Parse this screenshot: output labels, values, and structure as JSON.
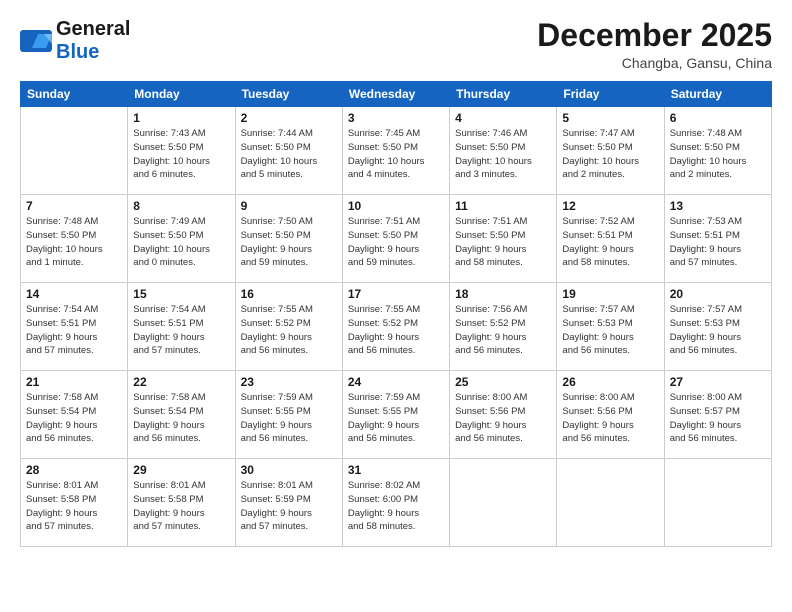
{
  "logo": {
    "line1": "General",
    "line2": "Blue"
  },
  "title": "December 2025",
  "location": "Changba, Gansu, China",
  "days_of_week": [
    "Sunday",
    "Monday",
    "Tuesday",
    "Wednesday",
    "Thursday",
    "Friday",
    "Saturday"
  ],
  "weeks": [
    [
      {
        "day": "",
        "info": ""
      },
      {
        "day": "1",
        "info": "Sunrise: 7:43 AM\nSunset: 5:50 PM\nDaylight: 10 hours\nand 6 minutes."
      },
      {
        "day": "2",
        "info": "Sunrise: 7:44 AM\nSunset: 5:50 PM\nDaylight: 10 hours\nand 5 minutes."
      },
      {
        "day": "3",
        "info": "Sunrise: 7:45 AM\nSunset: 5:50 PM\nDaylight: 10 hours\nand 4 minutes."
      },
      {
        "day": "4",
        "info": "Sunrise: 7:46 AM\nSunset: 5:50 PM\nDaylight: 10 hours\nand 3 minutes."
      },
      {
        "day": "5",
        "info": "Sunrise: 7:47 AM\nSunset: 5:50 PM\nDaylight: 10 hours\nand 2 minutes."
      },
      {
        "day": "6",
        "info": "Sunrise: 7:48 AM\nSunset: 5:50 PM\nDaylight: 10 hours\nand 2 minutes."
      }
    ],
    [
      {
        "day": "7",
        "info": "Sunrise: 7:48 AM\nSunset: 5:50 PM\nDaylight: 10 hours\nand 1 minute."
      },
      {
        "day": "8",
        "info": "Sunrise: 7:49 AM\nSunset: 5:50 PM\nDaylight: 10 hours\nand 0 minutes."
      },
      {
        "day": "9",
        "info": "Sunrise: 7:50 AM\nSunset: 5:50 PM\nDaylight: 9 hours\nand 59 minutes."
      },
      {
        "day": "10",
        "info": "Sunrise: 7:51 AM\nSunset: 5:50 PM\nDaylight: 9 hours\nand 59 minutes."
      },
      {
        "day": "11",
        "info": "Sunrise: 7:51 AM\nSunset: 5:50 PM\nDaylight: 9 hours\nand 58 minutes."
      },
      {
        "day": "12",
        "info": "Sunrise: 7:52 AM\nSunset: 5:51 PM\nDaylight: 9 hours\nand 58 minutes."
      },
      {
        "day": "13",
        "info": "Sunrise: 7:53 AM\nSunset: 5:51 PM\nDaylight: 9 hours\nand 57 minutes."
      }
    ],
    [
      {
        "day": "14",
        "info": "Sunrise: 7:54 AM\nSunset: 5:51 PM\nDaylight: 9 hours\nand 57 minutes."
      },
      {
        "day": "15",
        "info": "Sunrise: 7:54 AM\nSunset: 5:51 PM\nDaylight: 9 hours\nand 57 minutes."
      },
      {
        "day": "16",
        "info": "Sunrise: 7:55 AM\nSunset: 5:52 PM\nDaylight: 9 hours\nand 56 minutes."
      },
      {
        "day": "17",
        "info": "Sunrise: 7:55 AM\nSunset: 5:52 PM\nDaylight: 9 hours\nand 56 minutes."
      },
      {
        "day": "18",
        "info": "Sunrise: 7:56 AM\nSunset: 5:52 PM\nDaylight: 9 hours\nand 56 minutes."
      },
      {
        "day": "19",
        "info": "Sunrise: 7:57 AM\nSunset: 5:53 PM\nDaylight: 9 hours\nand 56 minutes."
      },
      {
        "day": "20",
        "info": "Sunrise: 7:57 AM\nSunset: 5:53 PM\nDaylight: 9 hours\nand 56 minutes."
      }
    ],
    [
      {
        "day": "21",
        "info": "Sunrise: 7:58 AM\nSunset: 5:54 PM\nDaylight: 9 hours\nand 56 minutes."
      },
      {
        "day": "22",
        "info": "Sunrise: 7:58 AM\nSunset: 5:54 PM\nDaylight: 9 hours\nand 56 minutes."
      },
      {
        "day": "23",
        "info": "Sunrise: 7:59 AM\nSunset: 5:55 PM\nDaylight: 9 hours\nand 56 minutes."
      },
      {
        "day": "24",
        "info": "Sunrise: 7:59 AM\nSunset: 5:55 PM\nDaylight: 9 hours\nand 56 minutes."
      },
      {
        "day": "25",
        "info": "Sunrise: 8:00 AM\nSunset: 5:56 PM\nDaylight: 9 hours\nand 56 minutes."
      },
      {
        "day": "26",
        "info": "Sunrise: 8:00 AM\nSunset: 5:56 PM\nDaylight: 9 hours\nand 56 minutes."
      },
      {
        "day": "27",
        "info": "Sunrise: 8:00 AM\nSunset: 5:57 PM\nDaylight: 9 hours\nand 56 minutes."
      }
    ],
    [
      {
        "day": "28",
        "info": "Sunrise: 8:01 AM\nSunset: 5:58 PM\nDaylight: 9 hours\nand 57 minutes."
      },
      {
        "day": "29",
        "info": "Sunrise: 8:01 AM\nSunset: 5:58 PM\nDaylight: 9 hours\nand 57 minutes."
      },
      {
        "day": "30",
        "info": "Sunrise: 8:01 AM\nSunset: 5:59 PM\nDaylight: 9 hours\nand 57 minutes."
      },
      {
        "day": "31",
        "info": "Sunrise: 8:02 AM\nSunset: 6:00 PM\nDaylight: 9 hours\nand 58 minutes."
      },
      {
        "day": "",
        "info": ""
      },
      {
        "day": "",
        "info": ""
      },
      {
        "day": "",
        "info": ""
      }
    ]
  ]
}
